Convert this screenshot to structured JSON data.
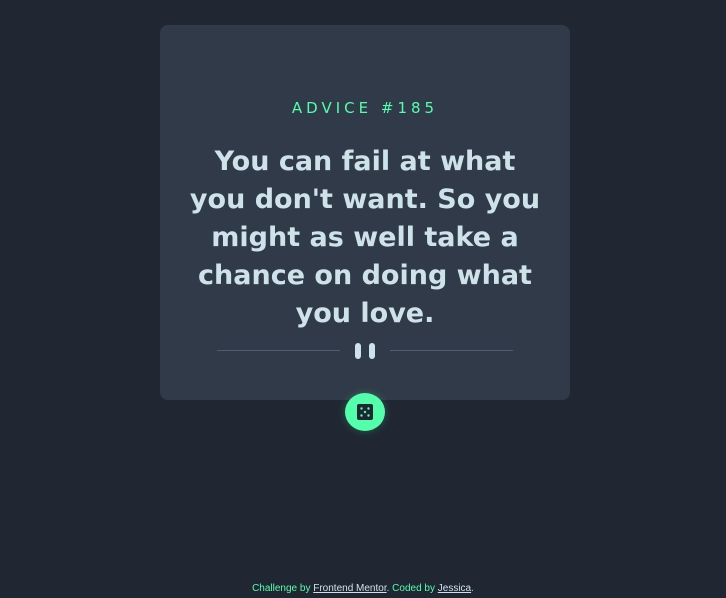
{
  "advice": {
    "id_label": "ADVICE #185",
    "quote": "You can fail at what you don't want. So you might as well take a chance on doing what you love."
  },
  "icons": {
    "divider": "pause-icon",
    "button": "dice-icon"
  },
  "footer": {
    "prefix": "Challenge by ",
    "challenge_link": "Frontend Mentor",
    "middle": ". Coded by ",
    "author_link": "Jessica",
    "suffix": "."
  },
  "colors": {
    "background": "#202733",
    "card": "#313a48",
    "accent": "#53ffab",
    "text": "#cee3e9",
    "divider": "#4f5d74"
  }
}
